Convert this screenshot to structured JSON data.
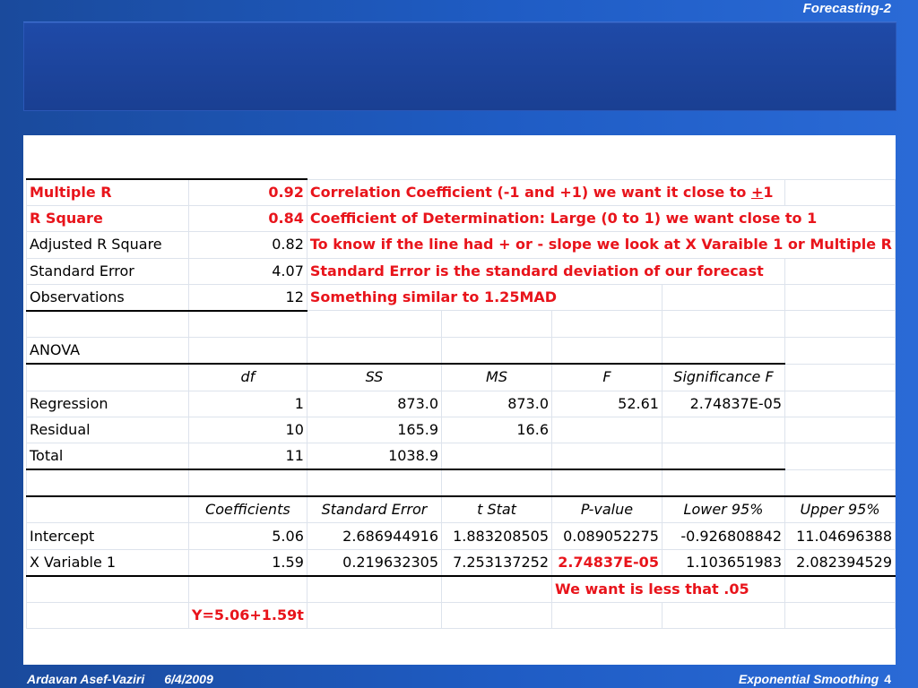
{
  "header": {
    "label": "Forecasting-2"
  },
  "regression_stats": {
    "rows": [
      {
        "label": "Multiple R",
        "value": "0.92",
        "note_pre": "Correlation Coefficient (-1 and +1) we want it close to ",
        "note_under": "+",
        "note_post": "1"
      },
      {
        "label": "R Square",
        "value": "0.84",
        "note": "Coefficient of Determination: Large (0 to 1) we want close to 1"
      },
      {
        "label": "Adjusted R Square",
        "value": "0.82",
        "note": "To know if the line had + or - slope we look at X Varaible 1 or Multiple R"
      },
      {
        "label": "Standard Error",
        "value": "4.07",
        "note": "Standard Error is the standard deviation of our forecast"
      },
      {
        "label": "Observations",
        "value": "12",
        "note": "Something similar to 1.25MAD"
      }
    ]
  },
  "anova": {
    "title": "ANOVA",
    "headers": [
      "df",
      "SS",
      "MS",
      "F",
      "Significance F"
    ],
    "rows": [
      {
        "label": "Regression",
        "df": "1",
        "ss": "873.0",
        "ms": "873.0",
        "f": "52.61",
        "sig": "2.74837E-05"
      },
      {
        "label": "Residual",
        "df": "10",
        "ss": "165.9",
        "ms": "16.6"
      },
      {
        "label": "Total",
        "df": "11",
        "ss": "1038.9"
      }
    ]
  },
  "coefficients": {
    "headers": [
      "Coefficients",
      "Standard Error",
      "t Stat",
      "P-value",
      "Lower 95%",
      "Upper 95%"
    ],
    "rows": [
      {
        "label": "Intercept",
        "coef": "5.06",
        "se": "2.686944916",
        "t": "1.883208505",
        "p": "0.089052275",
        "lower": "-0.926808842",
        "upper": "11.04696388"
      },
      {
        "label": "X Variable 1",
        "coef": "1.59",
        "se": "0.219632305",
        "t": "7.253137252",
        "p": "2.74837E-05",
        "lower": "1.103651983",
        "upper": "2.082394529"
      }
    ],
    "p_note": "We want is less that .05",
    "equation": "Y=5.06+1.59t"
  },
  "footer": {
    "author": "Ardavan Asef-Vaziri",
    "date": "6/4/2009",
    "topic": "Exponential Smoothing",
    "page": "4"
  }
}
